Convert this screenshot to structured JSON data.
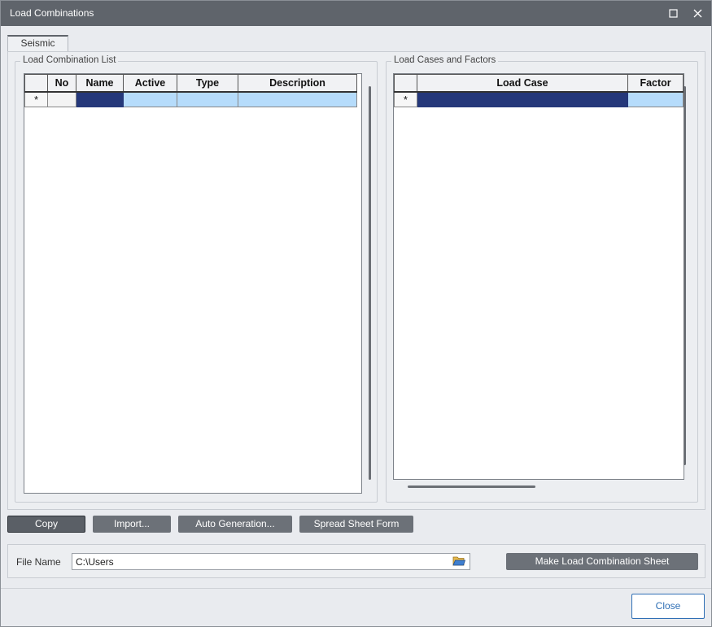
{
  "window": {
    "title": "Load Combinations",
    "maximize_icon": "maximize-icon",
    "close_icon": "close-icon"
  },
  "tabs": [
    {
      "label": "Seismic",
      "selected": true
    }
  ],
  "combination_list": {
    "title": "Load Combination List",
    "columns": [
      "",
      "No",
      "Name",
      "Active",
      "Type",
      "Description"
    ],
    "new_row_marker": "*"
  },
  "cases_factors": {
    "title": "Load Cases and Factors",
    "columns": [
      "",
      "Load Case",
      "Factor"
    ],
    "new_row_marker": "*"
  },
  "actions": {
    "copy": "Copy",
    "import": "Import...",
    "auto_generation": "Auto Generation...",
    "spread_sheet": "Spread Sheet Form"
  },
  "file": {
    "label": "File Name",
    "value": "C:\\Users",
    "browse_icon": "folder-open-icon",
    "make_sheet": "Make Load Combination Sheet"
  },
  "footer": {
    "close": "Close"
  },
  "colors": {
    "titlebar": "#5f646b",
    "selected_cell": "#25387a",
    "row_highlight": "#b6dcfb",
    "close_accent": "#2f6fb5"
  }
}
